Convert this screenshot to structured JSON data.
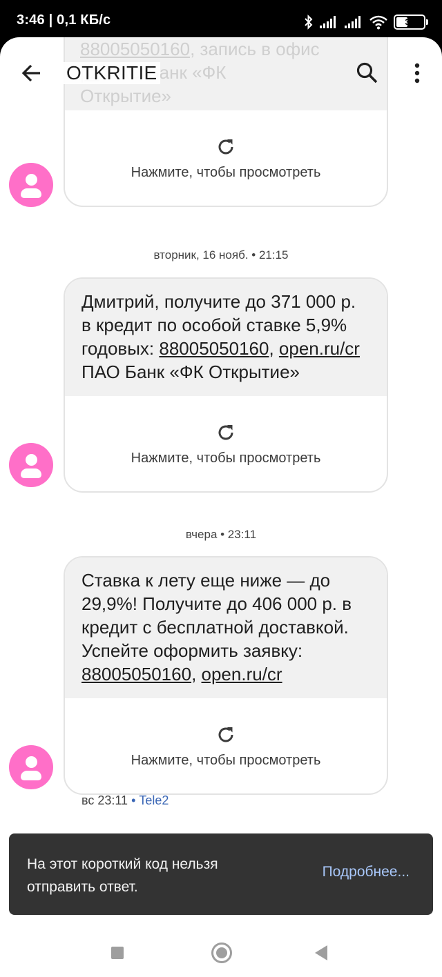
{
  "status_bar": {
    "time": "3:46 | 0,1 КБ/с",
    "battery_level": "38",
    "icons": [
      "bluetooth-icon",
      "signal-icon",
      "signal-icon",
      "wifi-icon",
      "battery-icon"
    ]
  },
  "app_bar": {
    "title": "OTKRITIE",
    "back_icon": "arrow-back-icon",
    "search_icon": "search-icon",
    "menu_icon": "more-vert-icon"
  },
  "partial_message": {
    "line1_number": "88005050160",
    "line1_rest": ", запись в офис",
    "line2_link": "pz",
    "line2_rest": " ПАО Банк «ФК",
    "line3": "Открытие»"
  },
  "messages": [
    {
      "preview_label": "Нажмите, чтобы просмотреть"
    },
    {
      "date": "вторник, 16 нояб. • 21:15",
      "text_lines": [
        "Дмитрий, получите до 371 000 р.",
        "в кредит по особой ставке 5,9%"
      ],
      "line3_prefix": "годовых: ",
      "phone": "88005050160",
      "separator": ", ",
      "url": "open.ru/cr",
      "line4": "ПАО Банк «ФК Открытие»",
      "preview_label": "Нажмите, чтобы просмотреть"
    },
    {
      "date": "вчера • 23:11",
      "text_lines": [
        "Ставка к лету еще ниже — до",
        "29,9%! Получите до 406 000 р. в",
        "кредит с бесплатной доставкой.",
        "Успейте оформить заявку:"
      ],
      "phone": "88005050160",
      "separator": ", ",
      "url": "open.ru/cr",
      "preview_label": "Нажмите, чтобы просмотреть",
      "meta_time": "вс 23:11",
      "meta_dot": " • ",
      "meta_carrier": "Tele2"
    }
  ],
  "snackbar": {
    "text": "На этот короткий код нельзя отправить ответ.",
    "action": "Подробнее..."
  },
  "nav_bar": {
    "icons": [
      "recent-apps-icon",
      "home-icon",
      "back-icon"
    ]
  },
  "colors": {
    "avatar": "#ff6fc8",
    "bubble": "#f1f1f1",
    "snackbar": "#333333",
    "snackbar_action": "#a8c7fa",
    "carrier": "#3a66b5"
  }
}
